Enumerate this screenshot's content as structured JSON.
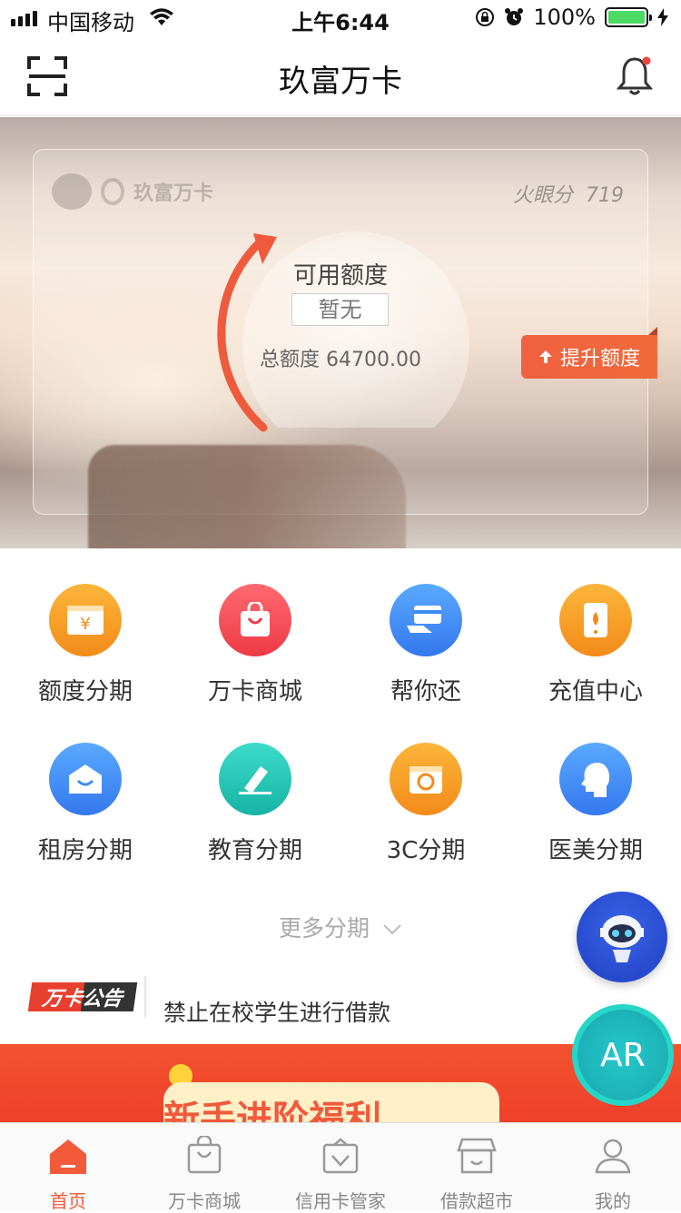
{
  "status_bar": {
    "carrier": "中国移动",
    "time": "上午6:44",
    "battery": "100%"
  },
  "nav": {
    "title": "玖富万卡"
  },
  "card": {
    "brand": "玖富万卡",
    "score_label": "火眼分",
    "score_value": "719",
    "available_label": "可用额度",
    "available_value": "暂无",
    "total_label": "总额度",
    "total_value": "64700.00",
    "raise_button": "提升额度"
  },
  "menu": {
    "items": [
      {
        "label": "额度分期",
        "icon": "yen-card-icon",
        "color": "#f6961f"
      },
      {
        "label": "万卡商城",
        "icon": "shopping-bag-icon",
        "color": "#f24a4e"
      },
      {
        "label": "帮你还",
        "icon": "hand-card-icon",
        "color": "#3a8ef0"
      },
      {
        "label": "充值中心",
        "icon": "phone-charge-icon",
        "color": "#f6961f"
      },
      {
        "label": "租房分期",
        "icon": "house-icon",
        "color": "#3a8ef0"
      },
      {
        "label": "教育分期",
        "icon": "pen-icon",
        "color": "#1fc1b6"
      },
      {
        "label": "3C分期",
        "icon": "camera-icon",
        "color": "#f6961f"
      },
      {
        "label": "医美分期",
        "icon": "face-profile-icon",
        "color": "#3a8ef0"
      }
    ],
    "more_label": "更多分期"
  },
  "notice": {
    "tag": "万卡公告",
    "text": "禁止在校学生进行借款"
  },
  "banner": {
    "text": "新手进阶福利"
  },
  "floaters": {
    "ar_label": "AR"
  },
  "tabbar": {
    "tabs": [
      {
        "label": "首页",
        "icon": "home-icon",
        "active": true
      },
      {
        "label": "万卡商城",
        "icon": "shopping-bag-icon",
        "active": false
      },
      {
        "label": "信用卡管家",
        "icon": "card-manager-icon",
        "active": false
      },
      {
        "label": "借款超市",
        "icon": "store-icon",
        "active": false
      },
      {
        "label": "我的",
        "icon": "person-icon",
        "active": false
      }
    ]
  },
  "colors": {
    "accent": "#f25a3a",
    "gauge_arc": "#f05a3c"
  }
}
